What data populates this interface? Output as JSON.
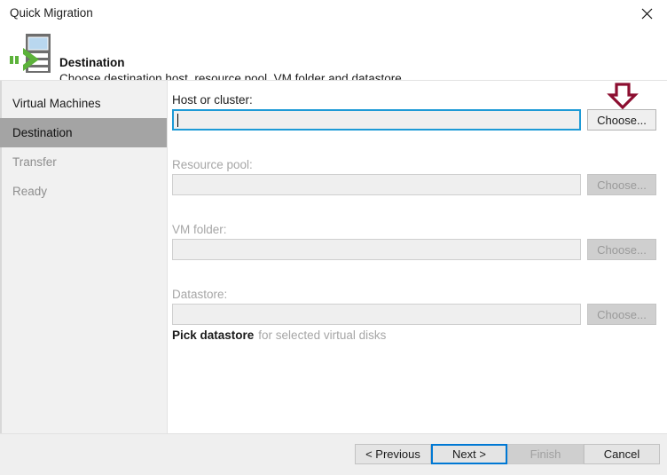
{
  "window": {
    "title": "Quick Migration",
    "close_icon": "close-icon"
  },
  "header": {
    "icon": "host-migration-icon",
    "title": "Destination",
    "subtitle": "Choose destination host, resource pool, VM folder and datastore."
  },
  "sidebar": {
    "items": [
      {
        "label": "Virtual Machines",
        "state": "done"
      },
      {
        "label": "Destination",
        "state": "active"
      },
      {
        "label": "Transfer",
        "state": "pending"
      },
      {
        "label": "Ready",
        "state": "pending"
      }
    ]
  },
  "main": {
    "fields": [
      {
        "label": "Host or cluster:",
        "value": "",
        "enabled": true,
        "focused": true,
        "button_label": "Choose..."
      },
      {
        "label": "Resource pool:",
        "value": "",
        "enabled": false,
        "focused": false,
        "button_label": "Choose..."
      },
      {
        "label": "VM folder:",
        "value": "",
        "enabled": false,
        "focused": false,
        "button_label": "Choose..."
      },
      {
        "label": "Datastore:",
        "value": "",
        "enabled": false,
        "focused": false,
        "button_label": "Choose..."
      }
    ],
    "pick_datastore": {
      "link_label": "Pick datastore",
      "rest_text": "for selected virtual disks"
    },
    "annotation": {
      "icon": "down-arrow-annotation-icon",
      "color": "#8c0e30",
      "points_at": "Choose..."
    }
  },
  "footer": {
    "buttons": [
      {
        "label": "< Previous",
        "state": "normal"
      },
      {
        "label": "Next >",
        "state": "focused"
      },
      {
        "label": "Finish",
        "state": "disabled"
      },
      {
        "label": "Cancel",
        "state": "normal"
      }
    ]
  },
  "colors": {
    "focus_blue": "#0078d4",
    "input_focus_border": "#1d9ad6",
    "sidebar_active": "#a4a4a4",
    "annotation_maroon": "#8c0e30",
    "icon_green": "#4aa832",
    "panel_gray": "#efefef"
  }
}
